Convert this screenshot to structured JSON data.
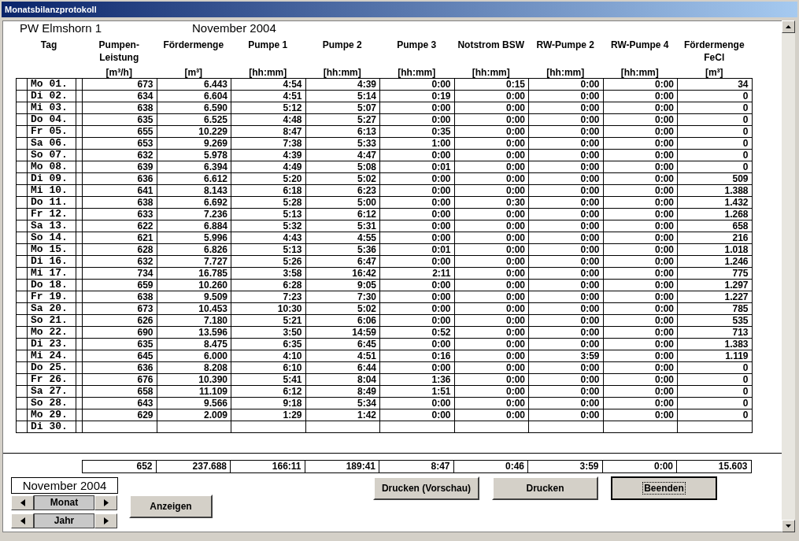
{
  "window": {
    "title": "Monatsbilanzprotokoll"
  },
  "station": "PW Elmshorn 1",
  "period": "November 2004",
  "columns": [
    {
      "label": "Tag"
    },
    {
      "label": "Pumpen-\nLeistung",
      "unit": "[m³/h]"
    },
    {
      "label": "Fördermenge",
      "unit": "[m³]"
    },
    {
      "label": "Pumpe 1",
      "unit": "[hh:mm]"
    },
    {
      "label": "Pumpe 2",
      "unit": "[hh:mm]"
    },
    {
      "label": "Pumpe 3",
      "unit": "[hh:mm]"
    },
    {
      "label": "Notstrom BSW",
      "unit": "[hh:mm]"
    },
    {
      "label": "RW-Pumpe 2",
      "unit": "[hh:mm]"
    },
    {
      "label": "RW-Pumpe 4",
      "unit": "[hh:mm]"
    },
    {
      "label": "Fördermenge\nFeCl",
      "unit": "[m³]"
    }
  ],
  "rows": [
    {
      "day": "Mo 01.",
      "values": [
        "673",
        "6.443",
        "4:54",
        "4:39",
        "0:00",
        "0:15",
        "0:00",
        "0:00",
        "34"
      ]
    },
    {
      "day": "Di 02.",
      "values": [
        "634",
        "6.604",
        "4:51",
        "5:14",
        "0:19",
        "0:00",
        "0:00",
        "0:00",
        "0"
      ]
    },
    {
      "day": "Mi 03.",
      "values": [
        "638",
        "6.590",
        "5:12",
        "5:07",
        "0:00",
        "0:00",
        "0:00",
        "0:00",
        "0"
      ]
    },
    {
      "day": "Do 04.",
      "values": [
        "635",
        "6.525",
        "4:48",
        "5:27",
        "0:00",
        "0:00",
        "0:00",
        "0:00",
        "0"
      ]
    },
    {
      "day": "Fr 05.",
      "values": [
        "655",
        "10.229",
        "8:47",
        "6:13",
        "0:35",
        "0:00",
        "0:00",
        "0:00",
        "0"
      ]
    },
    {
      "day": "Sa 06.",
      "values": [
        "653",
        "9.269",
        "7:38",
        "5:33",
        "1:00",
        "0:00",
        "0:00",
        "0:00",
        "0"
      ]
    },
    {
      "day": "So 07.",
      "values": [
        "632",
        "5.978",
        "4:39",
        "4:47",
        "0:00",
        "0:00",
        "0:00",
        "0:00",
        "0"
      ]
    },
    {
      "day": "Mo 08.",
      "values": [
        "639",
        "6.394",
        "4:49",
        "5:08",
        "0:01",
        "0:00",
        "0:00",
        "0:00",
        "0"
      ]
    },
    {
      "day": "Di 09.",
      "values": [
        "636",
        "6.612",
        "5:20",
        "5:02",
        "0:00",
        "0:00",
        "0:00",
        "0:00",
        "509"
      ]
    },
    {
      "day": "Mi 10.",
      "values": [
        "641",
        "8.143",
        "6:18",
        "6:23",
        "0:00",
        "0:00",
        "0:00",
        "0:00",
        "1.388"
      ]
    },
    {
      "day": "Do 11.",
      "values": [
        "638",
        "6.692",
        "5:28",
        "5:00",
        "0:00",
        "0:30",
        "0:00",
        "0:00",
        "1.432"
      ]
    },
    {
      "day": "Fr 12.",
      "values": [
        "633",
        "7.236",
        "5:13",
        "6:12",
        "0:00",
        "0:00",
        "0:00",
        "0:00",
        "1.268"
      ]
    },
    {
      "day": "Sa 13.",
      "values": [
        "622",
        "6.884",
        "5:32",
        "5:31",
        "0:00",
        "0:00",
        "0:00",
        "0:00",
        "658"
      ]
    },
    {
      "day": "So 14.",
      "values": [
        "621",
        "5.996",
        "4:43",
        "4:55",
        "0:00",
        "0:00",
        "0:00",
        "0:00",
        "216"
      ]
    },
    {
      "day": "Mo 15.",
      "values": [
        "628",
        "6.826",
        "5:13",
        "5:36",
        "0:01",
        "0:00",
        "0:00",
        "0:00",
        "1.018"
      ]
    },
    {
      "day": "Di 16.",
      "values": [
        "632",
        "7.727",
        "5:26",
        "6:47",
        "0:00",
        "0:00",
        "0:00",
        "0:00",
        "1.246"
      ]
    },
    {
      "day": "Mi 17.",
      "values": [
        "734",
        "16.785",
        "3:58",
        "16:42",
        "2:11",
        "0:00",
        "0:00",
        "0:00",
        "775"
      ]
    },
    {
      "day": "Do 18.",
      "values": [
        "659",
        "10.260",
        "6:28",
        "9:05",
        "0:00",
        "0:00",
        "0:00",
        "0:00",
        "1.297"
      ]
    },
    {
      "day": "Fr 19.",
      "values": [
        "638",
        "9.509",
        "7:23",
        "7:30",
        "0:00",
        "0:00",
        "0:00",
        "0:00",
        "1.227"
      ]
    },
    {
      "day": "Sa 20.",
      "values": [
        "673",
        "10.453",
        "10:30",
        "5:02",
        "0:00",
        "0:00",
        "0:00",
        "0:00",
        "785"
      ]
    },
    {
      "day": "So 21.",
      "values": [
        "626",
        "7.180",
        "5:21",
        "6:06",
        "0:00",
        "0:00",
        "0:00",
        "0:00",
        "535"
      ]
    },
    {
      "day": "Mo 22.",
      "values": [
        "690",
        "13.596",
        "3:50",
        "14:59",
        "0:52",
        "0:00",
        "0:00",
        "0:00",
        "713"
      ]
    },
    {
      "day": "Di 23.",
      "values": [
        "635",
        "8.475",
        "6:35",
        "6:45",
        "0:00",
        "0:00",
        "0:00",
        "0:00",
        "1.383"
      ]
    },
    {
      "day": "Mi 24.",
      "values": [
        "645",
        "6.000",
        "4:10",
        "4:51",
        "0:16",
        "0:00",
        "3:59",
        "0:00",
        "1.119"
      ]
    },
    {
      "day": "Do 25.",
      "values": [
        "636",
        "8.208",
        "6:10",
        "6:44",
        "0:00",
        "0:00",
        "0:00",
        "0:00",
        "0"
      ]
    },
    {
      "day": "Fr 26.",
      "values": [
        "676",
        "10.390",
        "5:41",
        "8:04",
        "1:36",
        "0:00",
        "0:00",
        "0:00",
        "0"
      ]
    },
    {
      "day": "Sa 27.",
      "values": [
        "658",
        "11.109",
        "6:12",
        "8:49",
        "1:51",
        "0:00",
        "0:00",
        "0:00",
        "0"
      ]
    },
    {
      "day": "So 28.",
      "values": [
        "643",
        "9.566",
        "9:18",
        "5:34",
        "0:00",
        "0:00",
        "0:00",
        "0:00",
        "0"
      ]
    },
    {
      "day": "Mo 29.",
      "values": [
        "629",
        "2.009",
        "1:29",
        "1:42",
        "0:00",
        "0:00",
        "0:00",
        "0:00",
        "0"
      ]
    },
    {
      "day": "Di 30.",
      "values": []
    }
  ],
  "totals": [
    "652",
    "237.688",
    "166:11",
    "189:41",
    "8:47",
    "0:46",
    "3:59",
    "0:00",
    "15.603"
  ],
  "selector": {
    "value": "November 2004",
    "month_label": "Monat",
    "year_label": "Jahr"
  },
  "buttons": [
    {
      "label": "Anzeigen",
      "focused": false
    },
    {
      "label": "Drucken (Vorschau)",
      "focused": false
    },
    {
      "label": "Drucken",
      "focused": false
    },
    {
      "label": "Beenden",
      "focused": true
    }
  ]
}
